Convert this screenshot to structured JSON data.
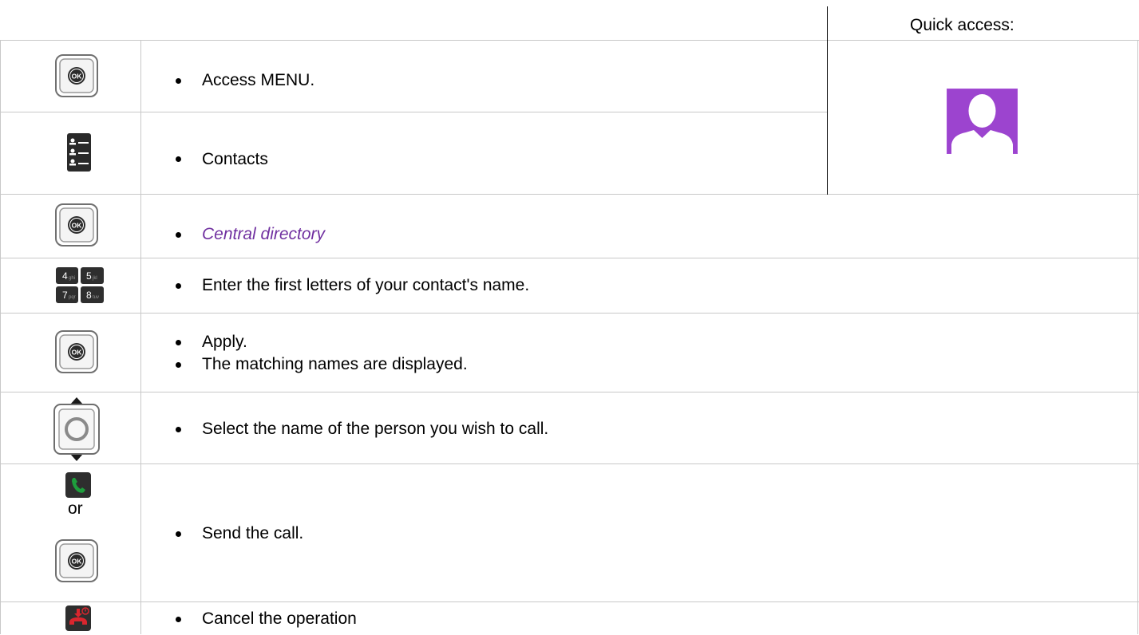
{
  "quick_access": {
    "label": "Quick access:",
    "icon": "contact-avatar-icon",
    "icon_color": "#a64dd6"
  },
  "rows": [
    {
      "icon": "ok-button-icon",
      "items": [
        "Access MENU."
      ]
    },
    {
      "icon": "contacts-list-icon",
      "items": [
        "Contacts"
      ]
    },
    {
      "icon": "ok-button-icon",
      "items": [
        "Central directory"
      ],
      "style": "link"
    },
    {
      "icon": "keypad-icon",
      "items": [
        "Enter the first letters of your contact's name."
      ]
    },
    {
      "icon": "ok-button-icon",
      "items": [
        "Apply.",
        "The matching names are displayed."
      ]
    },
    {
      "icon": "navigator-up-down-icon",
      "items": [
        "Select the name of the person you wish to call."
      ]
    },
    {
      "icon": "call-or-ok-icon",
      "connector": "or",
      "items": [
        "Send the call."
      ]
    },
    {
      "icon": "hang-up-icon",
      "items": [
        "Cancel the operation"
      ]
    }
  ],
  "colors": {
    "link": "#7030a0",
    "call_green": "#1e9e3c",
    "hangup_red": "#d9262e",
    "grid": "#c8c8c8"
  }
}
